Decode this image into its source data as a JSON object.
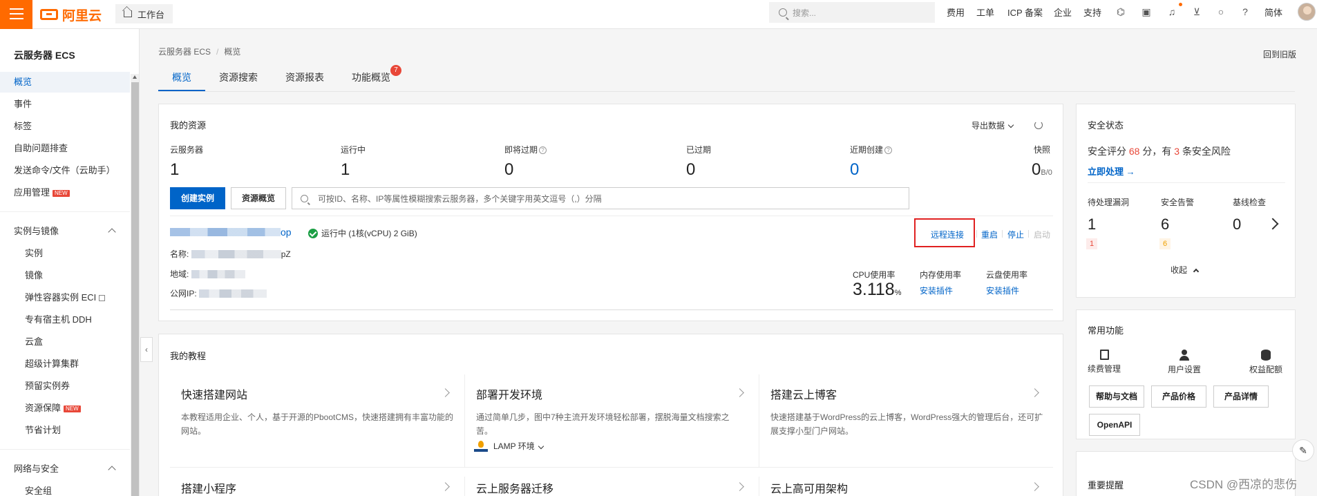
{
  "topbar": {
    "logo_text": "阿里云",
    "workbench": "工作台",
    "search_placeholder": "搜索...",
    "nav": [
      "费用",
      "工单",
      "ICP 备案",
      "企业",
      "支持"
    ],
    "lang": "简体",
    "icons": [
      "cloud-shell-icon",
      "terminal-icon",
      "bell-icon",
      "cart-icon",
      "lightbulb-icon",
      "help-icon"
    ]
  },
  "sidebar": {
    "title": "云服务器 ECS",
    "top_items": [
      {
        "label": "概览",
        "active": true
      },
      {
        "label": "事件"
      },
      {
        "label": "标签"
      },
      {
        "label": "自助问题排查"
      },
      {
        "label": "发送命令/文件（云助手）"
      },
      {
        "label": "应用管理",
        "badge": "NEW"
      }
    ],
    "group1": {
      "title": "实例与镜像",
      "items": [
        {
          "label": "实例"
        },
        {
          "label": "镜像"
        },
        {
          "label": "弹性容器实例 ECI",
          "external": true
        },
        {
          "label": "专有宿主机 DDH"
        },
        {
          "label": "云盒"
        },
        {
          "label": "超级计算集群"
        },
        {
          "label": "预留实例券"
        },
        {
          "label": "资源保障",
          "badge": "NEW"
        },
        {
          "label": "节省计划"
        }
      ]
    },
    "group2": {
      "title": "网络与安全",
      "items": [
        {
          "label": "安全组"
        }
      ]
    }
  },
  "main": {
    "breadcrumb": [
      "云服务器 ECS",
      "概览"
    ],
    "back_old": "回到旧版",
    "tabs": [
      {
        "label": "概览",
        "active": true
      },
      {
        "label": "资源搜索"
      },
      {
        "label": "资源报表"
      },
      {
        "label": "功能概览",
        "badge": "7"
      }
    ],
    "resources": {
      "title": "我的资源",
      "export": "导出数据",
      "stats": [
        {
          "label": "云服务器",
          "value": "1"
        },
        {
          "label": "运行中",
          "value": "1"
        },
        {
          "label": "即将过期",
          "value": "0",
          "help": true
        },
        {
          "label": "已过期",
          "value": "0"
        },
        {
          "label": "近期创建",
          "value": "0",
          "help": true,
          "blue": true
        },
        {
          "label": "快照",
          "value": "0",
          "unit": "B/0"
        }
      ],
      "create_btn": "创建实例",
      "overview_btn": "资源概览",
      "search_placeholder": "可按ID、名称、IP等属性模糊搜索云服务器，多个关键字用英文逗号（,）分隔",
      "instance": {
        "id_tail": "op",
        "status": "运行中",
        "spec": "(1核(vCPU) 2 GiB)",
        "name_label": "名称:",
        "name_tail": "pZ",
        "region_label": "地域:",
        "ip_label": "公网IP:",
        "actions": [
          "远程连接",
          "重启",
          "停止",
          "启动"
        ],
        "cpu_label": "CPU使用率",
        "cpu_value": "3.118",
        "cpu_unit": "%",
        "mem_label": "内存使用率",
        "disk_label": "云盘使用率",
        "install_plugin": "安装插件"
      }
    },
    "tutorials": {
      "title": "我的教程",
      "items": [
        {
          "title": "快速搭建网站",
          "desc": "本教程适用企业、个人，基于开源的PbootCMS，快速搭建拥有丰富功能的网站。"
        },
        {
          "title": "部署开发环境",
          "desc": "通过简单几步，图中7种主流开发环境轻松部署，摆脱海量文档搜索之苦。",
          "env": "LAMP 环境"
        },
        {
          "title": "搭建云上博客",
          "desc": "快速搭建基于WordPress的云上博客，WordPress强大的管理后台，还可扩展支撑小型门户网站。"
        },
        {
          "title": "搭建小程序"
        },
        {
          "title": "云上服务器迁移"
        },
        {
          "title": "云上高可用架构"
        }
      ]
    }
  },
  "right": {
    "security": {
      "title": "安全状态",
      "score_prefix": "安全评分",
      "score": "68",
      "score_mid": "分，有",
      "risk_count": "3",
      "score_suffix": "条安全风险",
      "handle_now": "立即处理 →",
      "stats": [
        {
          "label": "待处理漏洞",
          "value": "1",
          "mini": "1"
        },
        {
          "label": "安全告警",
          "value": "6",
          "mini": "6"
        },
        {
          "label": "基线检查",
          "value": "0"
        }
      ],
      "collapse": "收起"
    },
    "common": {
      "title": "常用功能",
      "items": [
        "续费管理",
        "用户设置",
        "权益配额"
      ],
      "buttons": [
        "帮助与文档",
        "产品价格",
        "产品详情",
        "OpenAPI"
      ]
    },
    "notice": {
      "title": "重要提醒"
    }
  },
  "watermark": "CSDN @西凉的悲伤"
}
